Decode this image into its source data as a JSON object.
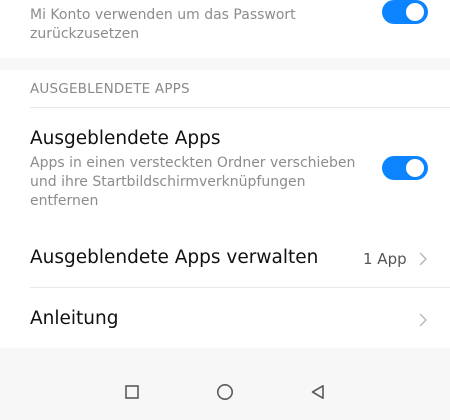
{
  "top_setting": {
    "subtitle_line1": "Mi Konto verwenden um das Passwort",
    "subtitle_line2": "zurückzusetzen",
    "toggle_on": true
  },
  "section": {
    "header": "AUSGEBLENDETE APPS"
  },
  "hidden_apps": {
    "title": "Ausgeblendete Apps",
    "desc_line1": "Apps in einen versteckten Ordner verschieben",
    "desc_line2": "und ihre Startbildschirmverknüpfungen",
    "desc_line3": "entfernen",
    "toggle_on": true
  },
  "manage_hidden_apps": {
    "title": "Ausgeblendete Apps verwalten",
    "value": "1 App"
  },
  "guide": {
    "title": "Anleitung"
  },
  "icons": {
    "toggle": "toggle-switch",
    "chevron": "chevron-right-icon",
    "recent": "square-icon",
    "home": "circle-icon",
    "back": "triangle-back-icon"
  },
  "colors": {
    "accent": "#0d84ff",
    "background": "#f7f7f7",
    "card": "#ffffff"
  }
}
